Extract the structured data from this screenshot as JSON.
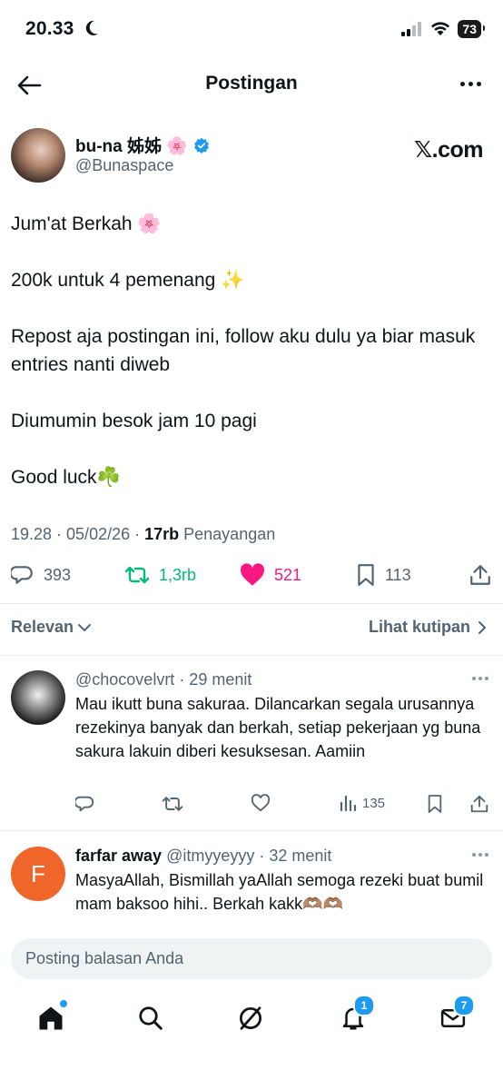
{
  "status_bar": {
    "time": "20.33",
    "battery": "73"
  },
  "header": {
    "title": "Postingan"
  },
  "post": {
    "display_name": "bu-na 姊姊 🌸",
    "handle": "@Bunaspace",
    "brand": "𝕏.com",
    "body": [
      "Jum'at Berkah 🌸",
      "200k untuk 4 pemenang ✨",
      "Repost aja postingan ini, follow aku dulu ya biar masuk entries nanti diweb",
      "Diumumin besok jam 10 pagi",
      "Good luck☘️"
    ],
    "timestamp": "19.28 · 05/02/26 · ",
    "views_count": "17rb",
    "views_label": " Penayangan",
    "replies": "393",
    "reposts": "1,3rb",
    "likes": "521",
    "bookmarks": "113"
  },
  "filter": {
    "sort_label": "Relevan",
    "quotes_link": "Lihat kutipan"
  },
  "replies": [
    {
      "handle": "@chocovelvrt",
      "time": " · 29 menit",
      "text": "Mau ikutt buna sakuraa. Dilancarkan segala urusannya rezekinya banyak dan berkah, setiap pekerjaan yg buna sakura lakuin diberi kesuksesan. Aamiin",
      "views": "135"
    },
    {
      "name": "farfar away",
      "handle": "@itmyyeyyy",
      "time": " · 32 menit",
      "avatar_letter": "F",
      "text": "MasyaAllah, Bismillah yaAllah semoga rezeki buat bumil mam baksoo hihi.. Berkah kakk🫶🏽🫶🏽"
    }
  ],
  "composer": {
    "placeholder": "Posting balasan Anda"
  },
  "tabs": {
    "notifications_badge": "1",
    "messages_badge": "7"
  },
  "colors": {
    "accent": "#1d9bf0",
    "like": "#f91880",
    "repost": "#00ba7c",
    "muted": "#536471"
  }
}
